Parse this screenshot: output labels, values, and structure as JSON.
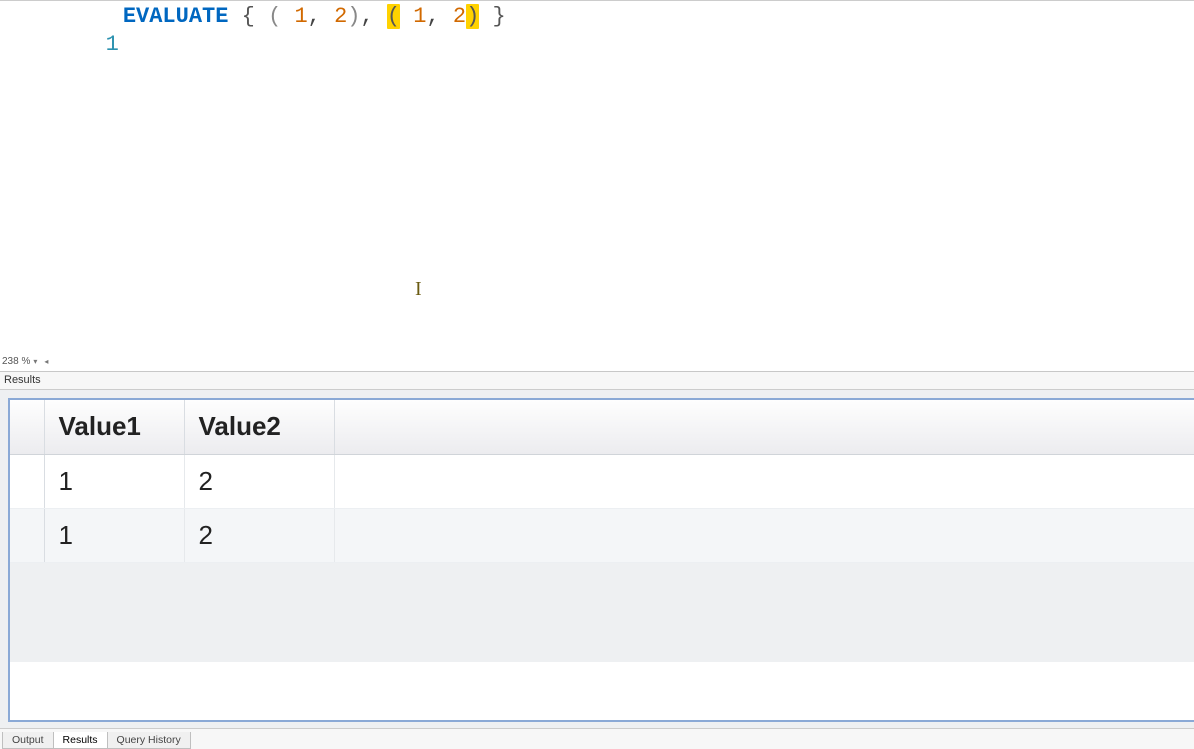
{
  "editor": {
    "line_number": "1",
    "tokens": {
      "keyword": "EVALUATE",
      "open_brace": "{",
      "open_paren1": "(",
      "num_a1": "1",
      "comma1": ",",
      "num_a2": "2",
      "close_paren1": ")",
      "comma_mid": ",",
      "open_paren2_hl": "(",
      "num_b1": "1",
      "comma2": ",",
      "num_b2": "2",
      "close_paren2_hl": ")",
      "close_brace": "}"
    },
    "zoom_label": "238 %"
  },
  "results": {
    "panel_title": "Results",
    "columns": [
      "Value1",
      "Value2"
    ],
    "rows": [
      {
        "v1": "1",
        "v2": "2"
      },
      {
        "v1": "1",
        "v2": "2"
      }
    ]
  },
  "tabs": {
    "items": [
      "Output",
      "Results",
      "Query History"
    ],
    "active_index": 1
  }
}
